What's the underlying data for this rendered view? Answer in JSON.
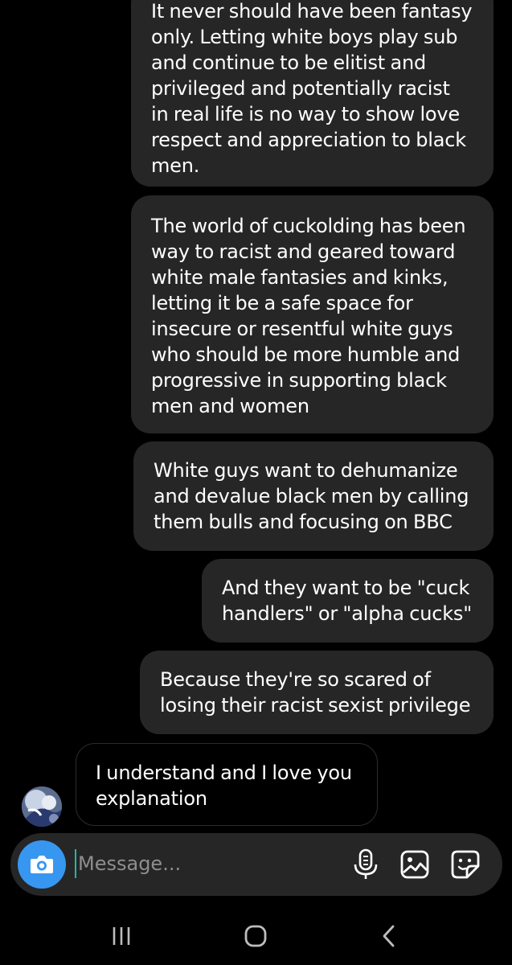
{
  "messages": [
    {
      "direction": "outgoing",
      "lines": [
        "It never should have been fantasy",
        "only. Letting white boys play sub",
        "and continue to be elitist and",
        "privileged and potentially racist",
        "in real life is no way to show love",
        "respect and appreciation to black",
        "men."
      ]
    },
    {
      "direction": "outgoing",
      "lines": [
        "The world of cuckolding has been",
        "way to racist and geared toward",
        "white male fantasies and kinks,",
        "letting it be a safe space for",
        "insecure or resentful white guys",
        "who should be more humble and",
        "progressive in supporting black",
        "men and women"
      ]
    },
    {
      "direction": "outgoing",
      "lines": [
        "White guys want to dehumanize",
        "and devalue black men by calling",
        "them bulls and focusing on BBC"
      ]
    },
    {
      "direction": "outgoing",
      "lines": [
        "And they want to be \"cuck",
        "handlers\" or \"alpha cucks\""
      ]
    },
    {
      "direction": "outgoing",
      "lines": [
        "Because they're so scared of",
        "losing their racist sexist privilege"
      ]
    },
    {
      "direction": "incoming",
      "lines": [
        "I understand and I love you",
        "explanation"
      ]
    }
  ],
  "composer": {
    "placeholder": "Message...",
    "icons": [
      "camera-icon",
      "microphone-icon",
      "gallery-icon",
      "sticker-icon"
    ]
  },
  "navigation": {
    "icons": [
      "recent-apps-icon",
      "home-icon",
      "back-icon"
    ]
  },
  "colors": {
    "background": "#000000",
    "outgoing_bubble": "#262626",
    "incoming_border": "#2c2c2c",
    "accent": "#3797f0",
    "cursor": "#1fb8a6",
    "placeholder": "#8e8e8e"
  }
}
